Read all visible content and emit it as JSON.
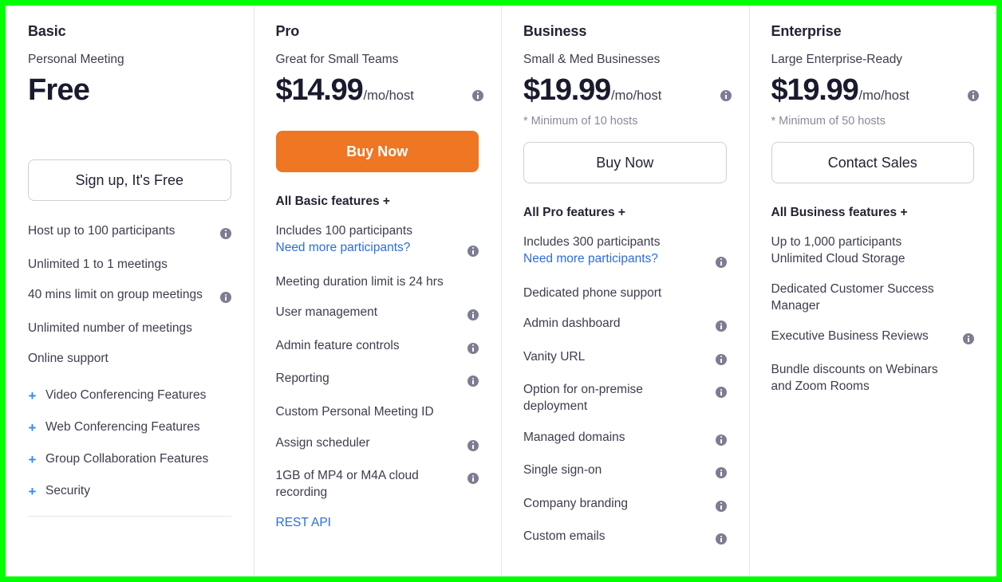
{
  "theme": {
    "accent_orange": "#EF7622",
    "link_blue": "#2D6CDF",
    "plus_blue": "#2D8CFF",
    "text_dark": "#232333",
    "text_body": "#3D3D4E",
    "muted": "#8A8A99",
    "highlight_border": "#00FF00"
  },
  "plans": [
    {
      "name": "Basic",
      "tagline": "Personal Meeting",
      "price": "Free",
      "price_unit": "",
      "price_has_info": false,
      "min_hosts_note": "",
      "cta_label": "Sign up, It's Free",
      "cta_style": "outline",
      "features_heading": "",
      "features": [
        {
          "text": "Host up to 100 participants",
          "info": true
        },
        {
          "text": "Unlimited 1 to 1 meetings",
          "info": false
        },
        {
          "text": "40 mins limit on group meetings",
          "info": true
        },
        {
          "text": "Unlimited number of meetings",
          "info": false
        },
        {
          "text": "Online support",
          "info": false
        }
      ],
      "accordions": [
        {
          "icon": "plus-icon",
          "label": "Video Conferencing Features"
        },
        {
          "icon": "plus-icon",
          "label": "Web Conferencing Features"
        },
        {
          "icon": "plus-icon",
          "label": "Group Collaboration Features"
        },
        {
          "icon": "plus-icon",
          "label": "Security"
        }
      ]
    },
    {
      "name": "Pro",
      "tagline": "Great for Small Teams",
      "price": "$14.99",
      "price_unit": "/mo/host",
      "price_has_info": true,
      "min_hosts_note": "",
      "cta_label": "Buy Now",
      "cta_style": "primary",
      "features_heading": "All Basic features +",
      "features": [
        {
          "text": "Includes 100 participants",
          "sub_link": "Need more participants?",
          "info": true
        },
        {
          "text": "Meeting duration limit is 24 hrs",
          "info": false
        },
        {
          "text": "User management",
          "info": true
        },
        {
          "text": "Admin feature controls",
          "info": true
        },
        {
          "text": "Reporting",
          "info": true
        },
        {
          "text": "Custom Personal Meeting ID",
          "info": false
        },
        {
          "text": "Assign scheduler",
          "info": true
        },
        {
          "text": "1GB of MP4 or M4A cloud recording",
          "info": true
        },
        {
          "text": "REST API",
          "link_only": true,
          "info": false
        }
      ],
      "accordions": []
    },
    {
      "name": "Business",
      "tagline": "Small & Med Businesses",
      "price": "$19.99",
      "price_unit": "/mo/host",
      "price_has_info": true,
      "min_hosts_note": "* Minimum of 10 hosts",
      "cta_label": "Buy Now",
      "cta_style": "outline",
      "features_heading": "All Pro features +",
      "features": [
        {
          "text": "Includes 300 participants",
          "sub_link": "Need more participants?",
          "info": true
        },
        {
          "text": "Dedicated phone support",
          "info": false
        },
        {
          "text": "Admin dashboard",
          "info": true
        },
        {
          "text": "Vanity URL",
          "info": true
        },
        {
          "text": "Option for on-premise deployment",
          "info": true
        },
        {
          "text": "Managed domains",
          "info": true
        },
        {
          "text": "Single sign-on",
          "info": true
        },
        {
          "text": "Company branding",
          "info": true
        },
        {
          "text": "Custom emails",
          "info": true
        }
      ],
      "accordions": []
    },
    {
      "name": "Enterprise",
      "tagline": "Large Enterprise-Ready",
      "price": "$19.99",
      "price_unit": "/mo/host",
      "price_has_info": true,
      "min_hosts_note": "* Minimum of 50 hosts",
      "cta_label": "Contact Sales",
      "cta_style": "outline",
      "features_heading": "All Business features +",
      "features": [
        {
          "text": "Up to 1,000 participants",
          "second_line": "Unlimited Cloud Storage",
          "info": false
        },
        {
          "text": "Dedicated Customer Success Manager",
          "info": false
        },
        {
          "text": "Executive Business Reviews",
          "info": true
        },
        {
          "text": "Bundle discounts on Webinars and Zoom Rooms",
          "info": false
        }
      ],
      "accordions": []
    }
  ]
}
